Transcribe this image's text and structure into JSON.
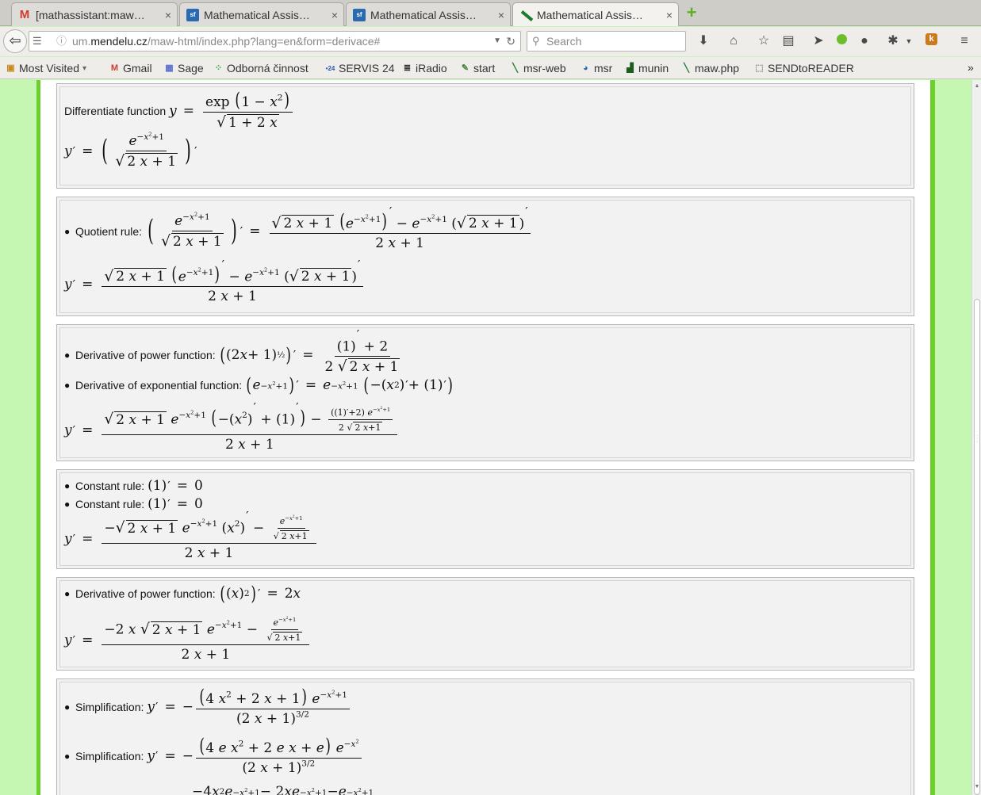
{
  "browser": {
    "tabs": [
      {
        "label": "[mathassistant:maw…",
        "icon": "gmail-icon",
        "close": "×"
      },
      {
        "label": "Mathematical Assis…",
        "icon": "sourceforge-icon",
        "close": "×"
      },
      {
        "label": "Mathematical Assis…",
        "icon": "sourceforge-icon",
        "close": "×"
      },
      {
        "label": "Mathematical Assis…",
        "icon": "maw-icon",
        "close": "×",
        "active": true
      }
    ],
    "new_tab": "+",
    "url": {
      "pre": "um.",
      "domain": "mendelu.cz",
      "path": "/maw-html/index.php?lang=en&form=derivace#"
    },
    "search_placeholder": "Search",
    "bookmarks": [
      {
        "label": "Most Visited",
        "icon": "folder-icon",
        "dropdown": "▾"
      },
      {
        "label": "Gmail",
        "icon": "gmail-icon"
      },
      {
        "label": "Sage",
        "icon": "sage-icon"
      },
      {
        "label": "Odborná činnost",
        "icon": "dots-icon"
      },
      {
        "label": "SERVIS 24",
        "icon": "servis24-icon"
      },
      {
        "label": "iRadio",
        "icon": "iradio-icon"
      },
      {
        "label": "start",
        "icon": "start-icon"
      },
      {
        "label": "msr-web",
        "icon": "maw-icon"
      },
      {
        "label": "msr",
        "icon": "globe-icon"
      },
      {
        "label": "munin",
        "icon": "munin-icon"
      },
      {
        "label": "maw.php",
        "icon": "maw-icon"
      },
      {
        "label": "SENDtoREADER",
        "icon": "page-icon"
      }
    ],
    "bookmarks_more": "»",
    "accent_color": "#6ccf2c",
    "page_background": "#c5f7b3"
  },
  "steps": {
    "s1": {
      "label": "Differentiate function"
    },
    "s2": {
      "rule": "Quotient rule:"
    },
    "s3": {
      "rule1": "Derivative of power function:",
      "rule2": "Derivative of exponential function:"
    },
    "s4": {
      "rule1": "Constant rule:",
      "rule2": "Constant rule:"
    },
    "s5": {
      "rule": "Derivative of power function:"
    },
    "s6": {
      "rule1": "Simplification:",
      "rule2": "Simplification:"
    }
  }
}
